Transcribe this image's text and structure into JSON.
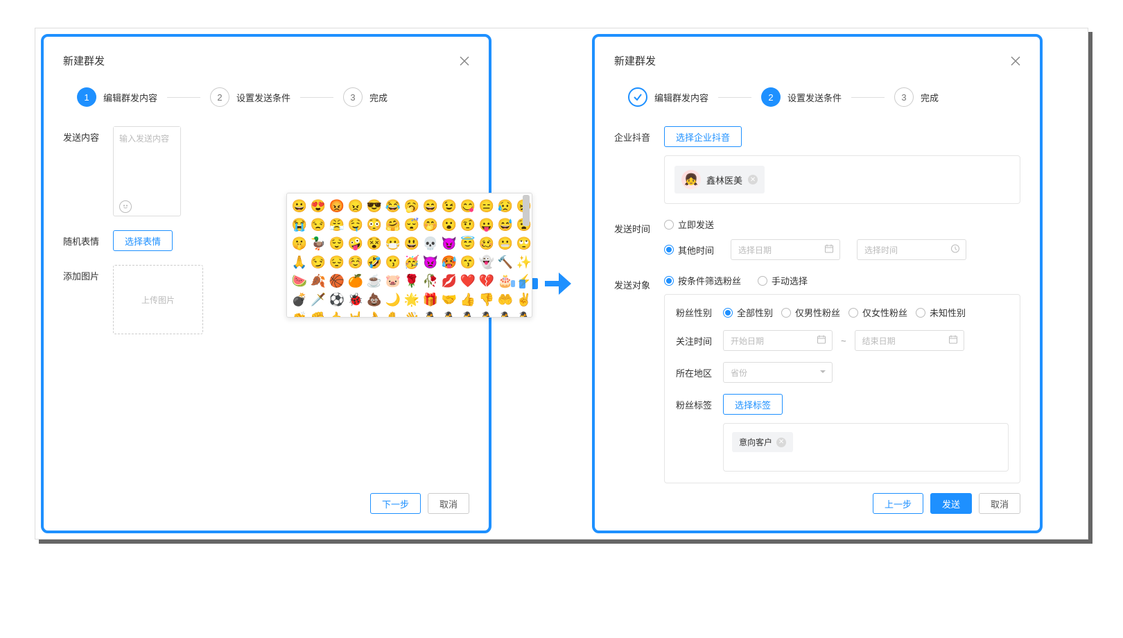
{
  "left": {
    "title": "新建群发",
    "steps": {
      "s1": "编辑群发内容",
      "s2": "设置发送条件",
      "s3": "完成",
      "n1": "1",
      "n2": "2",
      "n3": "3"
    },
    "labels": {
      "content": "发送内容",
      "random_emoji": "随机表情",
      "add_image": "添加图片"
    },
    "placeholder": "输入发送内容",
    "btn_select_emoji": "选择表情",
    "upload_text": "上传图片",
    "btn_next": "下一步",
    "btn_cancel": "取消",
    "emoji_rows": [
      [
        "😀",
        "😍",
        "😡",
        "😠",
        "😎",
        "😂",
        "🥱",
        "😄",
        "😉",
        "😋",
        "😑",
        "😥",
        "😖"
      ],
      [
        "😭",
        "😒",
        "😤",
        "🤤",
        "😳",
        "🤗",
        "😴",
        "🤭",
        "😮",
        "🤨",
        "😛",
        "😅",
        "😧"
      ],
      [
        "🤫",
        "🦆",
        "😌",
        "🤪",
        "😵",
        "😷",
        "😃",
        "💀",
        "😈",
        "😇",
        "🥴",
        "😬",
        "🙄"
      ],
      [
        "🙏",
        "😏",
        "😔",
        "☺️",
        "🤣",
        "😗",
        "🥳",
        "👿",
        "🥵",
        "😙",
        "👻",
        "🔨",
        "✨"
      ],
      [
        "🍉",
        "🍂",
        "🏀",
        "🍊",
        "☕",
        "🐷",
        "🌹",
        "🥀",
        "💋",
        "❤️",
        "💔",
        "🎂",
        "⚡"
      ],
      [
        "💣",
        "🗡️",
        "⚽",
        "🐞",
        "💩",
        "🌙",
        "🌟",
        "🎁",
        "🤝",
        "👍",
        "👎",
        "🤲",
        "✌️"
      ],
      [
        "👏",
        "✊",
        "🤙",
        "🤘",
        "👌",
        "✋",
        "👋",
        "🐧",
        "🐧",
        "🐧",
        "🐧",
        "🐧",
        "🐧"
      ]
    ]
  },
  "right": {
    "title": "新建群发",
    "steps": {
      "s1": "编辑群发内容",
      "s2": "设置发送条件",
      "s3": "完成",
      "n2": "2",
      "n3": "3"
    },
    "labels": {
      "account": "企业抖音",
      "send_time": "发送时间",
      "send_target": "发送对象",
      "gender": "粉丝性别",
      "follow_time": "关注时间",
      "region": "所在地区",
      "tags": "粉丝标签"
    },
    "btn_select_account": "选择企业抖音",
    "account_chip": "鑫林医美",
    "send_time_opts": {
      "now": "立即发送",
      "other": "其他时间"
    },
    "placeholders": {
      "pick_date": "选择日期",
      "pick_time": "选择时间",
      "start_date": "开始日期",
      "end_date": "结束日期",
      "province": "省份"
    },
    "target_opts": {
      "filter": "按条件筛选粉丝",
      "manual": "手动选择"
    },
    "gender_opts": {
      "all": "全部性别",
      "male": "仅男性粉丝",
      "female": "仅女性粉丝",
      "unknown": "未知性别"
    },
    "btn_select_tag": "选择标签",
    "tag_chip": "意向客户",
    "btn_prev": "上一步",
    "btn_send": "发送",
    "btn_cancel": "取消",
    "tilde": "~"
  }
}
